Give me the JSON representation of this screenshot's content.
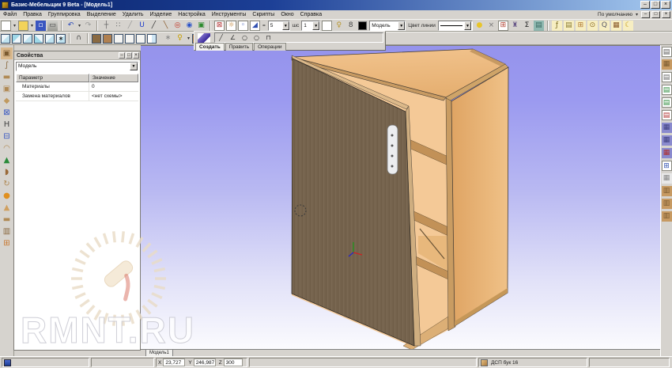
{
  "window": {
    "title": "Базис-Мебельщик 9 Beta - [Модель1]",
    "minimize": "–",
    "maximize": "□",
    "close": "×",
    "menu_controls_label": "По умолчанию",
    "mdi_minimize": "–",
    "mdi_restore": "□",
    "mdi_close": "×"
  },
  "menu": {
    "items": [
      {
        "n": "menu-file",
        "t": "Файл"
      },
      {
        "n": "menu-edit",
        "t": "Правка"
      },
      {
        "n": "menu-grouping",
        "t": "Группировка"
      },
      {
        "n": "menu-selection",
        "t": "Выделение"
      },
      {
        "n": "menu-delete",
        "t": "Удалить"
      },
      {
        "n": "menu-product",
        "t": "Изделие"
      },
      {
        "n": "menu-settings",
        "t": "Настройка"
      },
      {
        "n": "menu-tools",
        "t": "Инструменты"
      },
      {
        "n": "menu-scripts",
        "t": "Скрипты"
      },
      {
        "n": "menu-window",
        "t": "Окно"
      },
      {
        "n": "menu-help",
        "t": "Справка"
      }
    ]
  },
  "toolbar1": {
    "icons_a": [
      {
        "n": "new-file-icon",
        "cls": "bd",
        "g": ""
      },
      {
        "n": "new-file-dropdown",
        "cls": "arr",
        "g": "▾"
      },
      {
        "n": "open-file-icon",
        "cls": "bd",
        "b": "#f3d35a",
        "g": ""
      },
      {
        "n": "open-file-dropdown",
        "cls": "arr",
        "g": "▾"
      },
      {
        "n": "save-icon",
        "b": "#3a56c0",
        "g": "▫",
        "c": "#fff"
      },
      {
        "n": "print-icon",
        "b": "linear-gradient(#cfcfca,#9a9a94)",
        "g": "▭",
        "c": "#444"
      },
      {
        "cls": "sep",
        "ia": false
      },
      {
        "n": "undo-icon",
        "g": "↶",
        "c": "#2244bb"
      },
      {
        "n": "undo-dropdown",
        "cls": "arr",
        "g": "▾"
      },
      {
        "n": "redo-icon",
        "g": "↷",
        "c": "#999"
      },
      {
        "cls": "sep",
        "ia": false
      },
      {
        "n": "snap-move-icon",
        "g": "┼",
        "c": "#666"
      },
      {
        "n": "snap-grid-icon",
        "g": "∷",
        "c": "#666"
      },
      {
        "n": "ruler-icon",
        "g": "╱",
        "c": "#999"
      },
      {
        "n": "magnet-icon",
        "g": "U",
        "c": "#1a3acc"
      },
      {
        "n": "line-icon",
        "g": "╱",
        "c": "#333"
      },
      {
        "n": "pencil-icon",
        "g": "╲",
        "c": "#8a5a2a"
      },
      {
        "n": "zoom-red-icon",
        "g": "◎",
        "c": "#c03020"
      },
      {
        "n": "pan-icon",
        "g": "◉",
        "c": "#2a52c8"
      },
      {
        "n": "render-icon",
        "g": "▣",
        "c": "#2c8a2c"
      },
      {
        "cls": "sep",
        "ia": false
      },
      {
        "n": "zoom-window-icon",
        "cls": "bd",
        "g": "⊠",
        "c": "#b03030"
      },
      {
        "n": "zoom-all-icon",
        "cls": "bd",
        "g": "☼",
        "c": "#c08030"
      },
      {
        "n": "zoom-prev-icon",
        "cls": "bd",
        "g": "◦",
        "c": "#3050b0"
      },
      {
        "n": "zoom-select-icon",
        "cls": "bd",
        "g": "◢",
        "c": "#3050b0"
      }
    ],
    "eq_label": "=",
    "scale_value": "5",
    "shs_label": "шс",
    "size_value": "1",
    "light_glyph": "♀",
    "eight_glyph": "8",
    "model_value": "Модель",
    "line_color_label": "Цвет линии",
    "icons_b": [
      {
        "n": "material-ball-icon",
        "g": "●",
        "c": "#e8c52a"
      },
      {
        "n": "scissors-icon",
        "g": "×",
        "c": "#777"
      },
      {
        "n": "fragment-grid-icon",
        "cls": "bd",
        "g": "⊞",
        "c": "#b04030"
      },
      {
        "n": "stamp-icon",
        "g": "♜",
        "c": "#6a5a8a"
      },
      {
        "n": "sum-icon",
        "g": "Σ",
        "c": "#222"
      },
      {
        "n": "print-preview-icon",
        "b": "#8fb8b0",
        "g": "▤",
        "c": "#3a6a62"
      },
      {
        "cls": "sep",
        "ia": false
      },
      {
        "n": "script-edit-icon",
        "b": "#f7eec2",
        "g": "ƒ",
        "c": "#7a6a20"
      },
      {
        "n": "sheet-edit-icon",
        "b": "#f7eec2",
        "g": "▤",
        "c": "#8a7a30"
      },
      {
        "n": "table-icon",
        "b": "#f7eec2",
        "g": "⊞",
        "c": "#b07830"
      },
      {
        "n": "clock-icon",
        "b": "#f7eec2",
        "g": "⊙",
        "c": "#8a6a20"
      },
      {
        "n": "search-icon",
        "b": "#f7eec2",
        "g": "Q",
        "c": "#556"
      },
      {
        "n": "materials-cube-icon",
        "b": "#f7eec2",
        "g": "▦",
        "c": "#8a5a2a"
      },
      {
        "n": "moon-icon",
        "b": "#f7eec2",
        "g": "☾",
        "c": "#c8a020"
      }
    ]
  },
  "toolbar2": {
    "icons": [
      {
        "n": "view-iso-icon",
        "cls": "cub"
      },
      {
        "n": "view-front-icon",
        "cls": "cub",
        "b": "linear-gradient(135deg,#9fd8e8 50%,#eef6fa 50%)"
      },
      {
        "n": "view-side-icon",
        "cls": "cub"
      },
      {
        "n": "view-top-icon",
        "cls": "cub",
        "b": "linear-gradient(45deg,#9fd8e8 50%,#eef6fa 50%)"
      },
      {
        "n": "view-back-icon",
        "cls": "cub"
      },
      {
        "n": "view-custom-icon",
        "cls": "cub",
        "g": "∗"
      },
      {
        "cls": "sep",
        "ia": false
      },
      {
        "n": "rotate-view-icon",
        "g": "∩",
        "c": "#444"
      },
      {
        "cls": "sep",
        "ia": false
      },
      {
        "n": "shade-dark-icon",
        "cls": "cub",
        "b": "#8a6a42"
      },
      {
        "n": "shade-wood-icon",
        "cls": "cub",
        "b": "#b08050"
      },
      {
        "n": "wireframe-icon",
        "cls": "cub",
        "b": "#f4f4f2"
      },
      {
        "n": "hidden-line-icon",
        "cls": "cub",
        "b": "#f4f4f2"
      },
      {
        "n": "outline-icon",
        "cls": "cub",
        "b": "#f4f4f2"
      },
      {
        "n": "split-view-icon",
        "cls": "cub",
        "b": "linear-gradient(90deg,#fff 50%,#cfe6f4 50%)"
      },
      {
        "cls": "gap",
        "ia": false
      },
      {
        "n": "fan-icon",
        "g": "∗",
        "c": "#888"
      },
      {
        "n": "lamp-icon",
        "g": "♀",
        "c": "#c8a000"
      },
      {
        "n": "lamp-dropdown",
        "cls": "arr",
        "g": "▾"
      },
      {
        "n": "texture-cube-icon",
        "cls": "cub",
        "b": "#a87848"
      },
      {
        "n": "texture-dropdown",
        "cls": "arr",
        "g": "▾"
      }
    ],
    "panel": {
      "tabs": [
        {
          "n": "tab-create",
          "t": "Создать",
          "cls": "active"
        },
        {
          "n": "tab-edit",
          "t": "Править"
        },
        {
          "n": "tab-operations",
          "t": "Операции"
        }
      ],
      "shape_icons": [
        {
          "n": "line-shape-icon",
          "g": "╱",
          "c": "#333"
        },
        {
          "n": "angle-shape-icon",
          "g": "∠",
          "c": "#333"
        },
        {
          "n": "circle-shape-icon",
          "g": "○",
          "c": "#333"
        },
        {
          "n": "circle2-shape-icon",
          "g": "○",
          "c": "#333"
        },
        {
          "n": "arc-shape-icon",
          "g": "⊓",
          "c": "#333"
        }
      ]
    }
  },
  "left_toolbar": {
    "icons": [
      {
        "n": "panel-cube-icon",
        "g": "▣",
        "c": "#7a5a30",
        "b": "#d9b88c"
      },
      {
        "n": "clamp-icon",
        "g": "∫",
        "c": "#8a6a40"
      },
      {
        "n": "board-icon",
        "g": "▬",
        "c": "#b08a55"
      },
      {
        "n": "framed-board-icon",
        "g": "▣",
        "c": "#b08a55"
      },
      {
        "n": "eraser-icon",
        "g": "◆",
        "c": "#c09a60"
      },
      {
        "n": "panel-x-icon",
        "g": "⊠",
        "c": "#3050c0"
      },
      {
        "n": "panel-h-icon",
        "g": "H",
        "c": "#444"
      },
      {
        "n": "panel-split-icon",
        "g": "⊟",
        "c": "#3050c0"
      },
      {
        "n": "cap-icon",
        "g": "◠",
        "c": "#b08a55"
      },
      {
        "n": "bell-icon",
        "g": "▲",
        "c": "#2a8a3a"
      },
      {
        "n": "sole-icon",
        "g": "◗",
        "c": "#9a6a3a"
      },
      {
        "n": "rotate-panel-icon",
        "g": "↻",
        "c": "#b08a55"
      },
      {
        "n": "ball-icon",
        "g": "●",
        "c": "#e09020"
      },
      {
        "n": "cone-icon",
        "g": "▲",
        "c": "#d0a060"
      },
      {
        "n": "board2-icon",
        "g": "▬",
        "c": "#b08a55"
      },
      {
        "n": "box-icon",
        "g": "▥",
        "c": "#8a6a40"
      },
      {
        "n": "grid-orange-icon",
        "g": "⊞",
        "c": "#c87830"
      }
    ]
  },
  "right_toolbar": {
    "icons": [
      {
        "n": "doc-icon",
        "g": "▤",
        "c": "#555",
        "cls": "bd"
      },
      {
        "n": "wood-board-icon",
        "g": "▦",
        "c": "#7a5a30",
        "b": "#c79a62"
      },
      {
        "n": "doc2-icon",
        "g": "▤",
        "c": "#666",
        "cls": "bd"
      },
      {
        "n": "doc-green-icon",
        "g": "▤",
        "c": "#2a8a3a",
        "cls": "bd"
      },
      {
        "n": "doc-green2-icon",
        "g": "▤",
        "c": "#2a8a3a",
        "cls": "bd"
      },
      {
        "n": "doc-red-icon",
        "g": "▤",
        "c": "#b03030",
        "cls": "bd"
      },
      {
        "n": "purple-board-icon",
        "g": "▦",
        "c": "#404080",
        "b": "#8a8ace"
      },
      {
        "n": "purple-board2-icon",
        "g": "▦",
        "c": "#404080",
        "b": "#8a8ace"
      },
      {
        "n": "purple-board3-icon",
        "g": "▦",
        "c": "#b03030",
        "b": "#8a8ace"
      },
      {
        "n": "grid-blue-icon",
        "g": "⊞",
        "c": "#3050b0",
        "cls": "bd"
      },
      {
        "n": "gray-board-icon",
        "g": "▦",
        "c": "#888",
        "b": "#e8e8e8"
      },
      {
        "n": "tan-board-icon",
        "g": "▥",
        "c": "#7a5a30",
        "b": "#c79a62"
      },
      {
        "n": "tan-board2-icon",
        "g": "▥",
        "c": "#7a5a30",
        "b": "#c79a62"
      },
      {
        "n": "tan-board3-icon",
        "g": "▥",
        "c": "#7a5a30",
        "b": "#c79a62"
      }
    ]
  },
  "properties_panel": {
    "title": "Свойства",
    "minimize": "–",
    "maximize": "□",
    "close": "×",
    "combo_value": "Модель",
    "col_param": "Параметр",
    "col_value": "Значение",
    "rows": [
      {
        "param": "Материалы",
        "value": "0"
      },
      {
        "param": "Замена материалов",
        "value": "<нет схемы>"
      }
    ]
  },
  "viewport": {
    "doc_tab": "Модель1",
    "watermark_text": "RMNT.RU",
    "colors": {
      "bg_top": "#9593ec",
      "bg_bottom": "#fbfbfe",
      "wood_light": "#eebc80",
      "wood_edge": "#c79a62",
      "door_dark": "#75634d"
    }
  },
  "status_bar": {
    "x_label": "X",
    "x_value": "23,727",
    "y_label": "Y",
    "y_value": "246,987",
    "z_label": "Z",
    "z_value": "300",
    "material": "ДСП бук 16"
  }
}
